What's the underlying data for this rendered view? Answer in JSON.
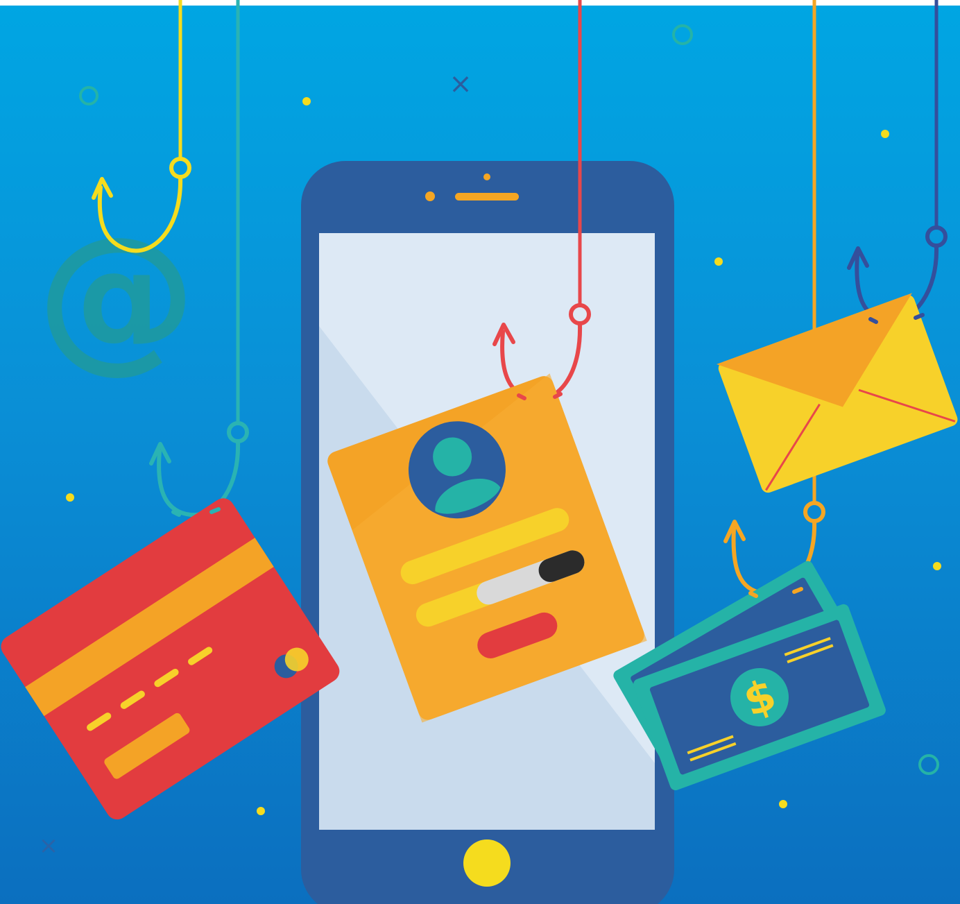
{
  "illustration": {
    "symbols": {
      "at_sign": "@",
      "currency": "$",
      "sparkle": "×"
    },
    "colors": {
      "background_top": "#00a6e3",
      "background_bottom": "#0b6fbf",
      "phone_body": "#2c5d9e",
      "phone_screen": "#dde9f5",
      "hook_yellow": "#f5dc1e",
      "hook_teal": "#2ab3b3",
      "hook_red": "#e8474a",
      "hook_orange": "#f5a623",
      "hook_navy": "#344f9c",
      "card_red": "#e23c3f",
      "login_orange": "#f4a326",
      "envelope_yellow": "#f7d12a",
      "bill_teal": "#25b3a7",
      "bill_navy": "#2c5d9e"
    },
    "icons": [
      "at-sign-icon",
      "credit-card-icon",
      "login-form-icon",
      "envelope-icon",
      "money-bills-icon",
      "fish-hook-icon",
      "smartphone-icon",
      "user-avatar-icon"
    ]
  }
}
